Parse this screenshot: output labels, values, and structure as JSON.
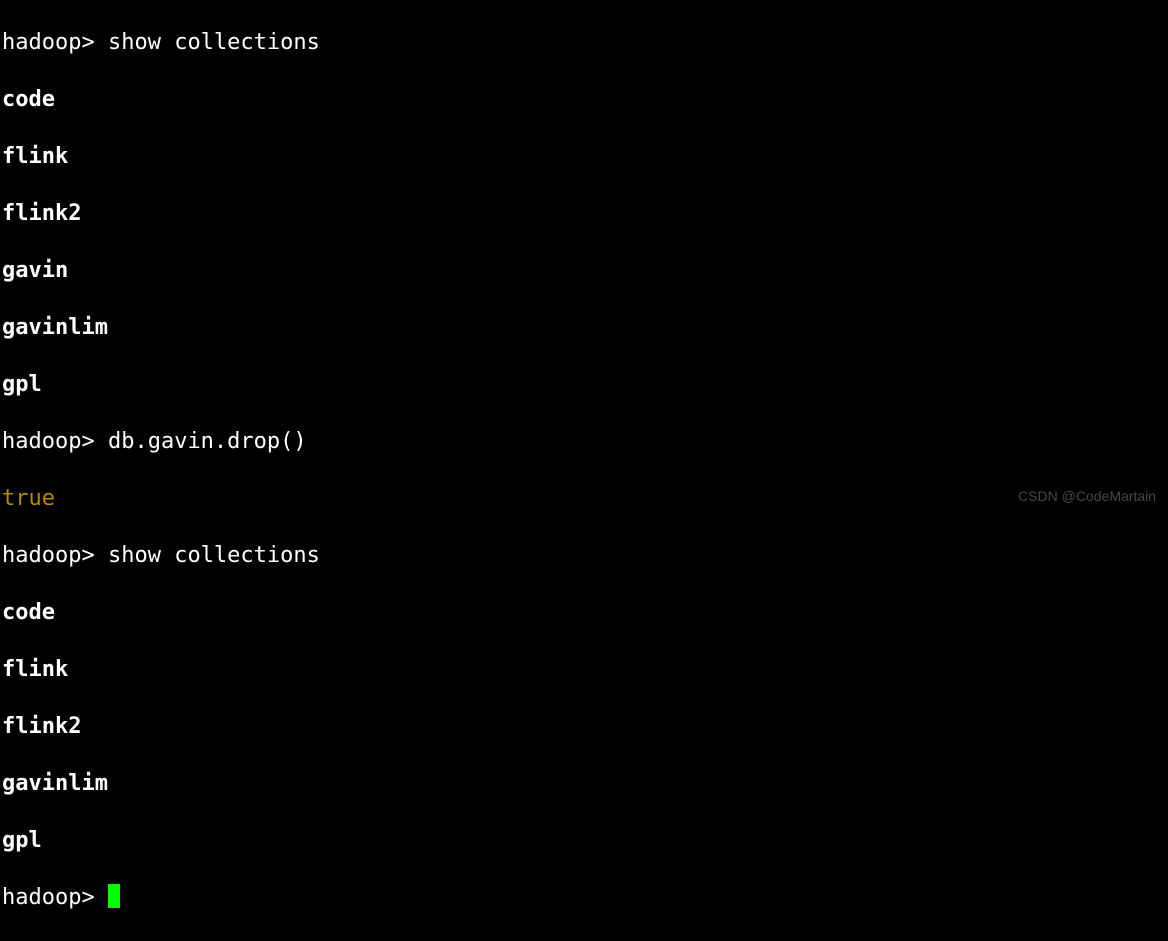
{
  "terminal": {
    "prompt": "hadoop>",
    "commands": {
      "show_collections": "show collections",
      "drop_gavin": "db.gavin.drop()"
    },
    "collections_before": [
      "code",
      "flink",
      "flink2",
      "gavin",
      "gavinlim",
      "gpl"
    ],
    "drop_result": "true",
    "collections_after": [
      "code",
      "flink",
      "flink2",
      "gavinlim",
      "gpl"
    ]
  },
  "watermark": "CSDN @CodeMartain"
}
